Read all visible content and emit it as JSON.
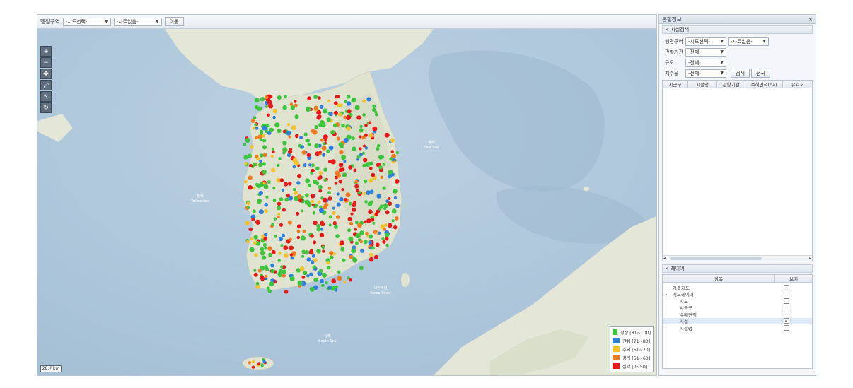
{
  "map_toolbar": {
    "region_label": "행정구역",
    "sido_select": "-시도선택-",
    "sigungu_select": "-자료없음-",
    "go_button": "이동"
  },
  "map_labels": {
    "east_sea_kr": "동해",
    "east_sea_en": "East Sea",
    "yellow_sea_kr": "황해",
    "yellow_sea_en": "Yellow Sea",
    "korea_strait_kr": "대한해협",
    "korea_strait_en": "Korea Strait",
    "south_sea_kr": "남해",
    "south_sea_en": "South Sea"
  },
  "map_tools": [
    "zoom-in-icon",
    "zoom-out-icon",
    "pan-icon",
    "full-extent-icon",
    "select-icon",
    "refresh-icon"
  ],
  "scale": "28.7 km",
  "legend": [
    {
      "label": "정상 [81~100]",
      "color": "#3cc43c"
    },
    {
      "label": "관심 [71~80]",
      "color": "#2f7fe0"
    },
    {
      "label": "주의 [61~70]",
      "color": "#f2c12e"
    },
    {
      "label": "경계 [51~60]",
      "color": "#f07a1c"
    },
    {
      "label": "심각 [0~50]",
      "color": "#e81818"
    }
  ],
  "side_panel": {
    "title": "통합정보",
    "close": "×",
    "facility_search": {
      "header": "시설검색",
      "rows": {
        "region_label": "행정구역",
        "region_sido": "-시도선택-",
        "region_sigungu": "-자료없음-",
        "agency_label": "관할기관",
        "agency_value": "-전체-",
        "scale_label": "규모",
        "scale_value": "-전체-",
        "reservoir_label": "저수율",
        "reservoir_value": "-전체-",
        "search_button": "검색",
        "all_button": "전국"
      },
      "columns": [
        "시군구",
        "시설명",
        "관할기관",
        "수혜면적(ha)",
        "유효저"
      ]
    },
    "layers": {
      "header": "레이어",
      "col_item": "항목",
      "col_view": "보기",
      "items": [
        {
          "name": "가뭄지도",
          "indent": 0,
          "checked": false,
          "toggle": ""
        },
        {
          "name": "지도레이어",
          "indent": 0,
          "checked": null,
          "toggle": "-"
        },
        {
          "name": "시도",
          "indent": 1,
          "checked": false,
          "toggle": ""
        },
        {
          "name": "시군구",
          "indent": 1,
          "checked": false,
          "toggle": ""
        },
        {
          "name": "수혜면적",
          "indent": 1,
          "checked": false,
          "toggle": ""
        },
        {
          "name": "시설",
          "indent": 1,
          "checked": true,
          "toggle": ""
        },
        {
          "name": "시설명",
          "indent": 1,
          "checked": false,
          "toggle": ""
        }
      ]
    }
  }
}
